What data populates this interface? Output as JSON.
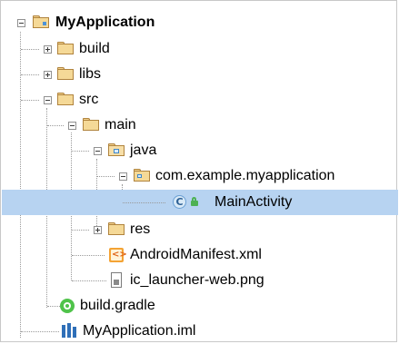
{
  "tree": {
    "root": {
      "label": "MyApplication",
      "expanded": true
    },
    "items": [
      {
        "label": "build",
        "expanded": false
      },
      {
        "label": "libs",
        "expanded": false
      },
      {
        "label": "src",
        "expanded": true
      },
      {
        "label": "main",
        "expanded": true
      },
      {
        "label": "java",
        "expanded": true
      },
      {
        "label": "com.example.myapplication",
        "expanded": true
      },
      {
        "label": "MainActivity",
        "selected": true
      },
      {
        "label": "res",
        "expanded": false
      },
      {
        "label": "AndroidManifest.xml"
      },
      {
        "label": "ic_launcher-web.png"
      },
      {
        "label": "build.gradle"
      },
      {
        "label": "MyApplication.iml"
      }
    ]
  },
  "icons": {
    "root": "module-folder-icon",
    "folder": "folder-icon",
    "source_root": "source-folder-icon",
    "package": "package-icon",
    "class": "class-icon",
    "lock": "lock-icon",
    "xml": "xml-file-icon",
    "png": "image-file-icon",
    "gradle": "gradle-icon",
    "iml": "iml-file-icon"
  },
  "colors": {
    "selection": "#b7d3f1",
    "folder": "#f5d997",
    "gradle": "#4fc34a",
    "class": "#6a9fd3"
  }
}
